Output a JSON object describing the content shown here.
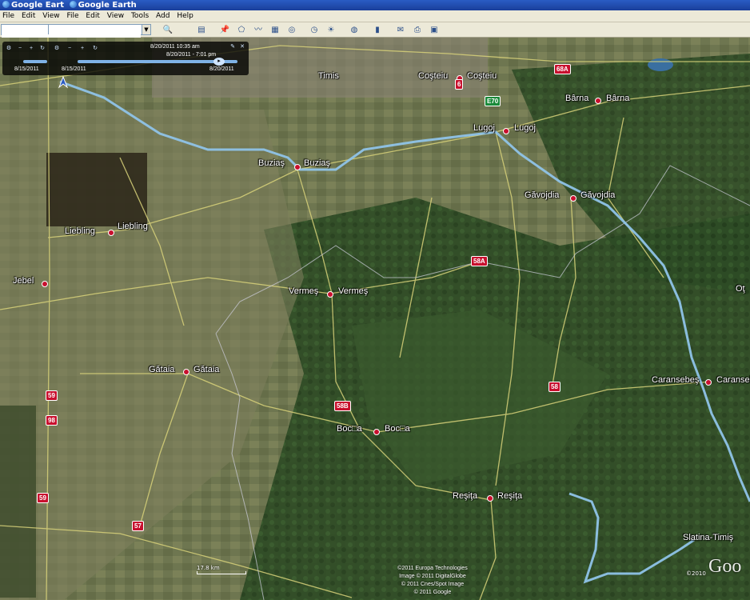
{
  "window": {
    "title_parts": [
      "Google Eart",
      "Google Earth"
    ]
  },
  "menu": [
    "File",
    "Edit",
    "View",
    "File",
    "Edit",
    "View",
    "Tools",
    "Add",
    "Help"
  ],
  "search": {
    "placeholder": "",
    "value": ""
  },
  "toolbar": {
    "icons": [
      "search-icon",
      "sidebar-icon",
      "placemark-icon",
      "polygon-icon",
      "path-icon",
      "overlay-icon",
      "tour-icon",
      "historical-imagery-icon",
      "sunlight-icon",
      "planets-icon",
      "ruler-icon",
      "email-icon",
      "print-icon",
      "maps-icon"
    ]
  },
  "timeslider": {
    "date_top": "8/20/2011 10:35 am",
    "date_mid": "8/20/2011 - 7:01 pm",
    "left_label_1": "8/15/2011",
    "left_label_2": "8/15/2011",
    "right_label": "8/20/2011"
  },
  "places": [
    {
      "name": "Timis",
      "dot": false
    },
    {
      "name": "Coşteiu",
      "dot": true
    },
    {
      "name": "Coşteiu",
      "dot": false
    },
    {
      "name": "Bârna",
      "dot": true
    },
    {
      "name": "Bârna",
      "dot": false
    },
    {
      "name": "Lugoj",
      "dot": true
    },
    {
      "name": "Lugoj",
      "dot": false
    },
    {
      "name": "Buziaş",
      "dot": true
    },
    {
      "name": "Buziaş",
      "dot": false
    },
    {
      "name": "Găvojdia",
      "dot": true
    },
    {
      "name": "Găvojdia",
      "dot": false
    },
    {
      "name": "Liebling",
      "dot": true
    },
    {
      "name": "Liebling",
      "dot": false
    },
    {
      "name": "Jebel",
      "dot": true
    },
    {
      "name": "Vermeş",
      "dot": true
    },
    {
      "name": "Vermeş",
      "dot": false
    },
    {
      "name": "Gătaia",
      "dot": true
    },
    {
      "name": "Gătaia",
      "dot": false
    },
    {
      "name": "Caransebeş",
      "dot": true
    },
    {
      "name": "Caranseb",
      "dot": false
    },
    {
      "name": "Boc□a",
      "dot": true
    },
    {
      "name": "Boc□a",
      "dot": false
    },
    {
      "name": "Reşiţa",
      "dot": true
    },
    {
      "name": "Reşiţa",
      "dot": false
    },
    {
      "name": "Slatina-Timiş",
      "dot": false
    },
    {
      "name": "Oţ",
      "dot": false
    }
  ],
  "road_shields": [
    "68A",
    "6",
    "E70",
    "58A",
    "58",
    "58B",
    "59",
    "59",
    "57",
    "98"
  ],
  "credits": [
    "©2011 Europa Technologies",
    "Image © 2011 DigitalGlobe",
    "© 2011 Cnes/Spot Image",
    "© 2011 Google"
  ],
  "scale_label": "17.8 km",
  "logo_year": "©2010",
  "logo_text": "Goo",
  "colors": {
    "route": "#8fc3e8",
    "roads": "#d8d27a",
    "dot": "#c8102e"
  }
}
